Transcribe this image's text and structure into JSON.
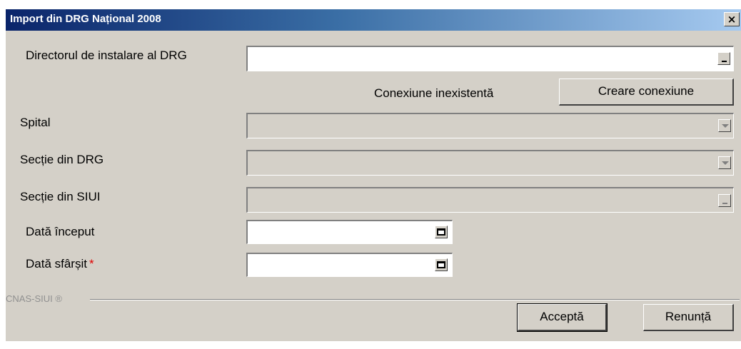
{
  "window": {
    "title": "Import din DRG Național 2008",
    "close_icon": "×"
  },
  "form": {
    "install_dir": {
      "label": "Directorul de instalare al DRG",
      "value": "",
      "browse_icon": "ellipsis-button-icon"
    },
    "connection": {
      "status": "Conexiune inexistentă",
      "create_button": "Creare conexiune"
    },
    "hospital": {
      "label": "Spital",
      "value": ""
    },
    "drg_section": {
      "label": "Secție din DRG",
      "value": ""
    },
    "siui_section": {
      "label": "Secție din SIUI",
      "value": ""
    },
    "start_date": {
      "label": "Dată început",
      "value": ""
    },
    "end_date": {
      "label": "Dată sfârșit",
      "required_mark": "*",
      "value": ""
    }
  },
  "brand": "CNAS-SIUI ®",
  "buttons": {
    "accept": "Acceptă",
    "cancel": "Renunță"
  },
  "colors": {
    "dialog_bg": "#d4d0c8",
    "title_gradient_start": "#0a246a",
    "title_gradient_end": "#a6caf0",
    "required": "#e00000"
  }
}
